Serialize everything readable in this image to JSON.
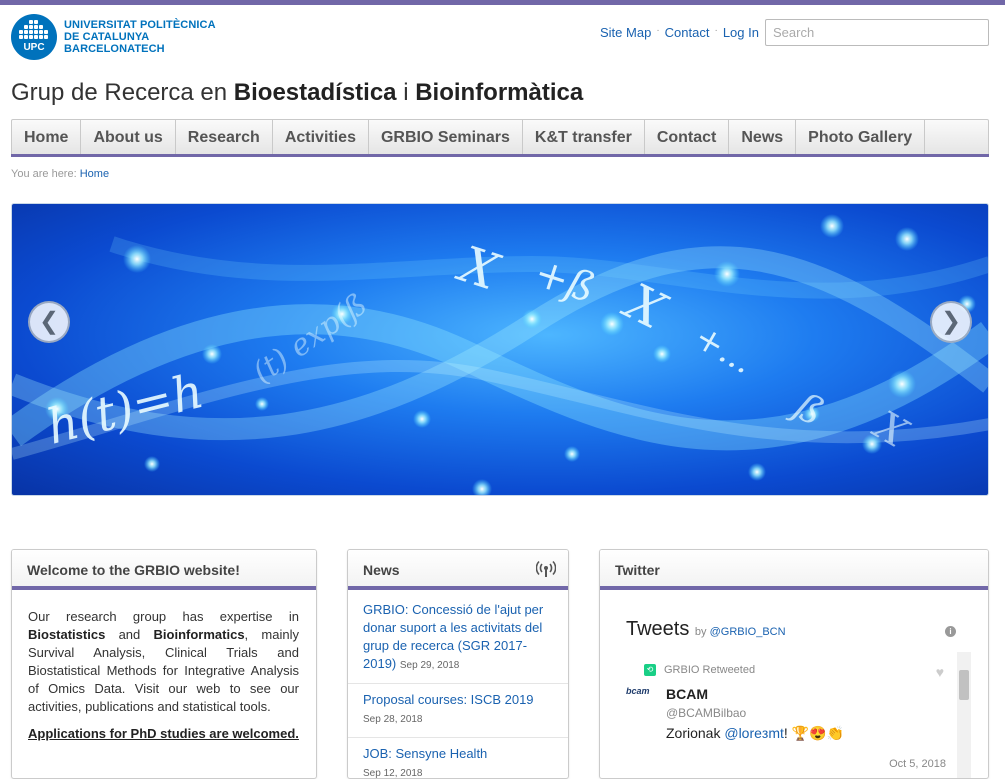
{
  "header": {
    "logo_lines": [
      "UNIVERSITAT POLITÈCNICA",
      "DE CATALUNYA",
      "BARCELONATECH"
    ],
    "logo_badge": "UPC",
    "links": [
      "Site Map",
      "Contact",
      "Log In"
    ],
    "search_placeholder": "Search",
    "site_title_prefix": "Grup de Recerca en ",
    "site_title_bold1": "Bioestadística",
    "site_title_mid": " i ",
    "site_title_bold2": "Bioinformàtica"
  },
  "nav": {
    "items": [
      "Home",
      "About us",
      "Research",
      "Activities",
      "GRBIO Seminars",
      "K&T transfer",
      "Contact",
      "News",
      "Photo Gallery"
    ]
  },
  "breadcrumb": {
    "prefix": "You are here:",
    "current": "Home"
  },
  "carousel": {
    "prev_icon": "chevron-left-icon",
    "next_icon": "chevron-right-icon",
    "prev": "❮",
    "next": "❯"
  },
  "welcome": {
    "title": "Welcome to the GRBIO website!",
    "t1": "Our research group has expertise in ",
    "b1": "Biostatistics",
    "t2": " and ",
    "b2": "Bioinformatics",
    "t3": ", mainly Survival Analysis, Clinical Trials and Biostatistical Methods for Integrative Analysis of Omics Data. Visit our web to see our activities, publications and statistical tools.",
    "apply": "Applications for PhD studies are welcomed."
  },
  "news": {
    "title": "News",
    "items": [
      {
        "title": "GRBIO: Concessió de l'ajut per donar suport a les activitats del grup de recerca (SGR 2017-2019)",
        "date": "Sep 29, 2018"
      },
      {
        "title": "Proposal courses: ISCB 2019",
        "date": "Sep 28, 2018"
      },
      {
        "title": "JOB: Sensyne Health",
        "date": "Sep 12, 2018"
      }
    ]
  },
  "twitter": {
    "title": "Twitter",
    "tweets_label": "Tweets",
    "by_label": "by",
    "handle_link": "@GRBIO_BCN",
    "info": "i",
    "retweet_label": "GRBIO Retweeted",
    "author_name": "BCAM",
    "author_handle": "@BCAMBilbao",
    "avatar_text": "bcam",
    "text_prefix": "Zorionak ",
    "mention": "@loreзmt",
    "text_suffix": "! 🏆😍👏",
    "date": "Oct 5, 2018"
  },
  "colors": {
    "accent": "#7167a8",
    "link": "#1a62b0",
    "upc_blue": "#0072bc"
  }
}
